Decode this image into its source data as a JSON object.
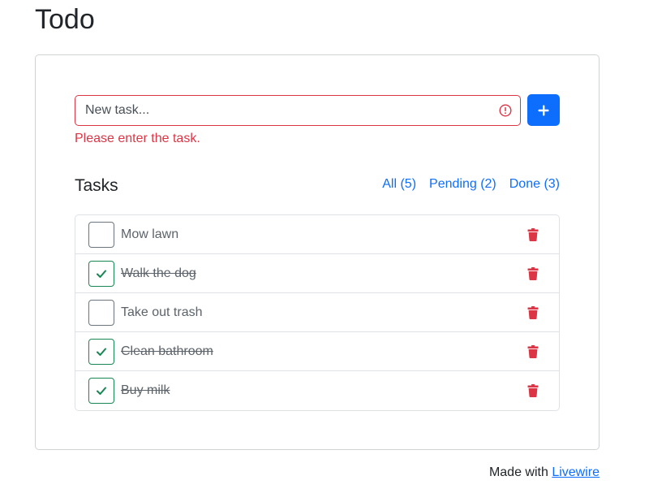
{
  "page": {
    "title": "Todo"
  },
  "form": {
    "placeholder": "New task...",
    "value": "",
    "error_message": "Please enter the task.",
    "add_icon": "plus-icon",
    "error_icon": "exclamation-circle-icon"
  },
  "tasks_section": {
    "heading": "Tasks",
    "filters": [
      {
        "label": "All (5)"
      },
      {
        "label": "Pending (2)"
      },
      {
        "label": "Done (3)"
      }
    ]
  },
  "tasks": [
    {
      "label": "Mow lawn",
      "done": false
    },
    {
      "label": "Walk the dog",
      "done": true
    },
    {
      "label": "Take out trash",
      "done": false
    },
    {
      "label": "Clean bathroom",
      "done": true
    },
    {
      "label": "Buy milk",
      "done": true
    }
  ],
  "footer": {
    "prefix": "Made with ",
    "link_text": "Livewire"
  },
  "colors": {
    "primary": "#0d6efd",
    "danger": "#dc3545",
    "success": "#198754"
  }
}
